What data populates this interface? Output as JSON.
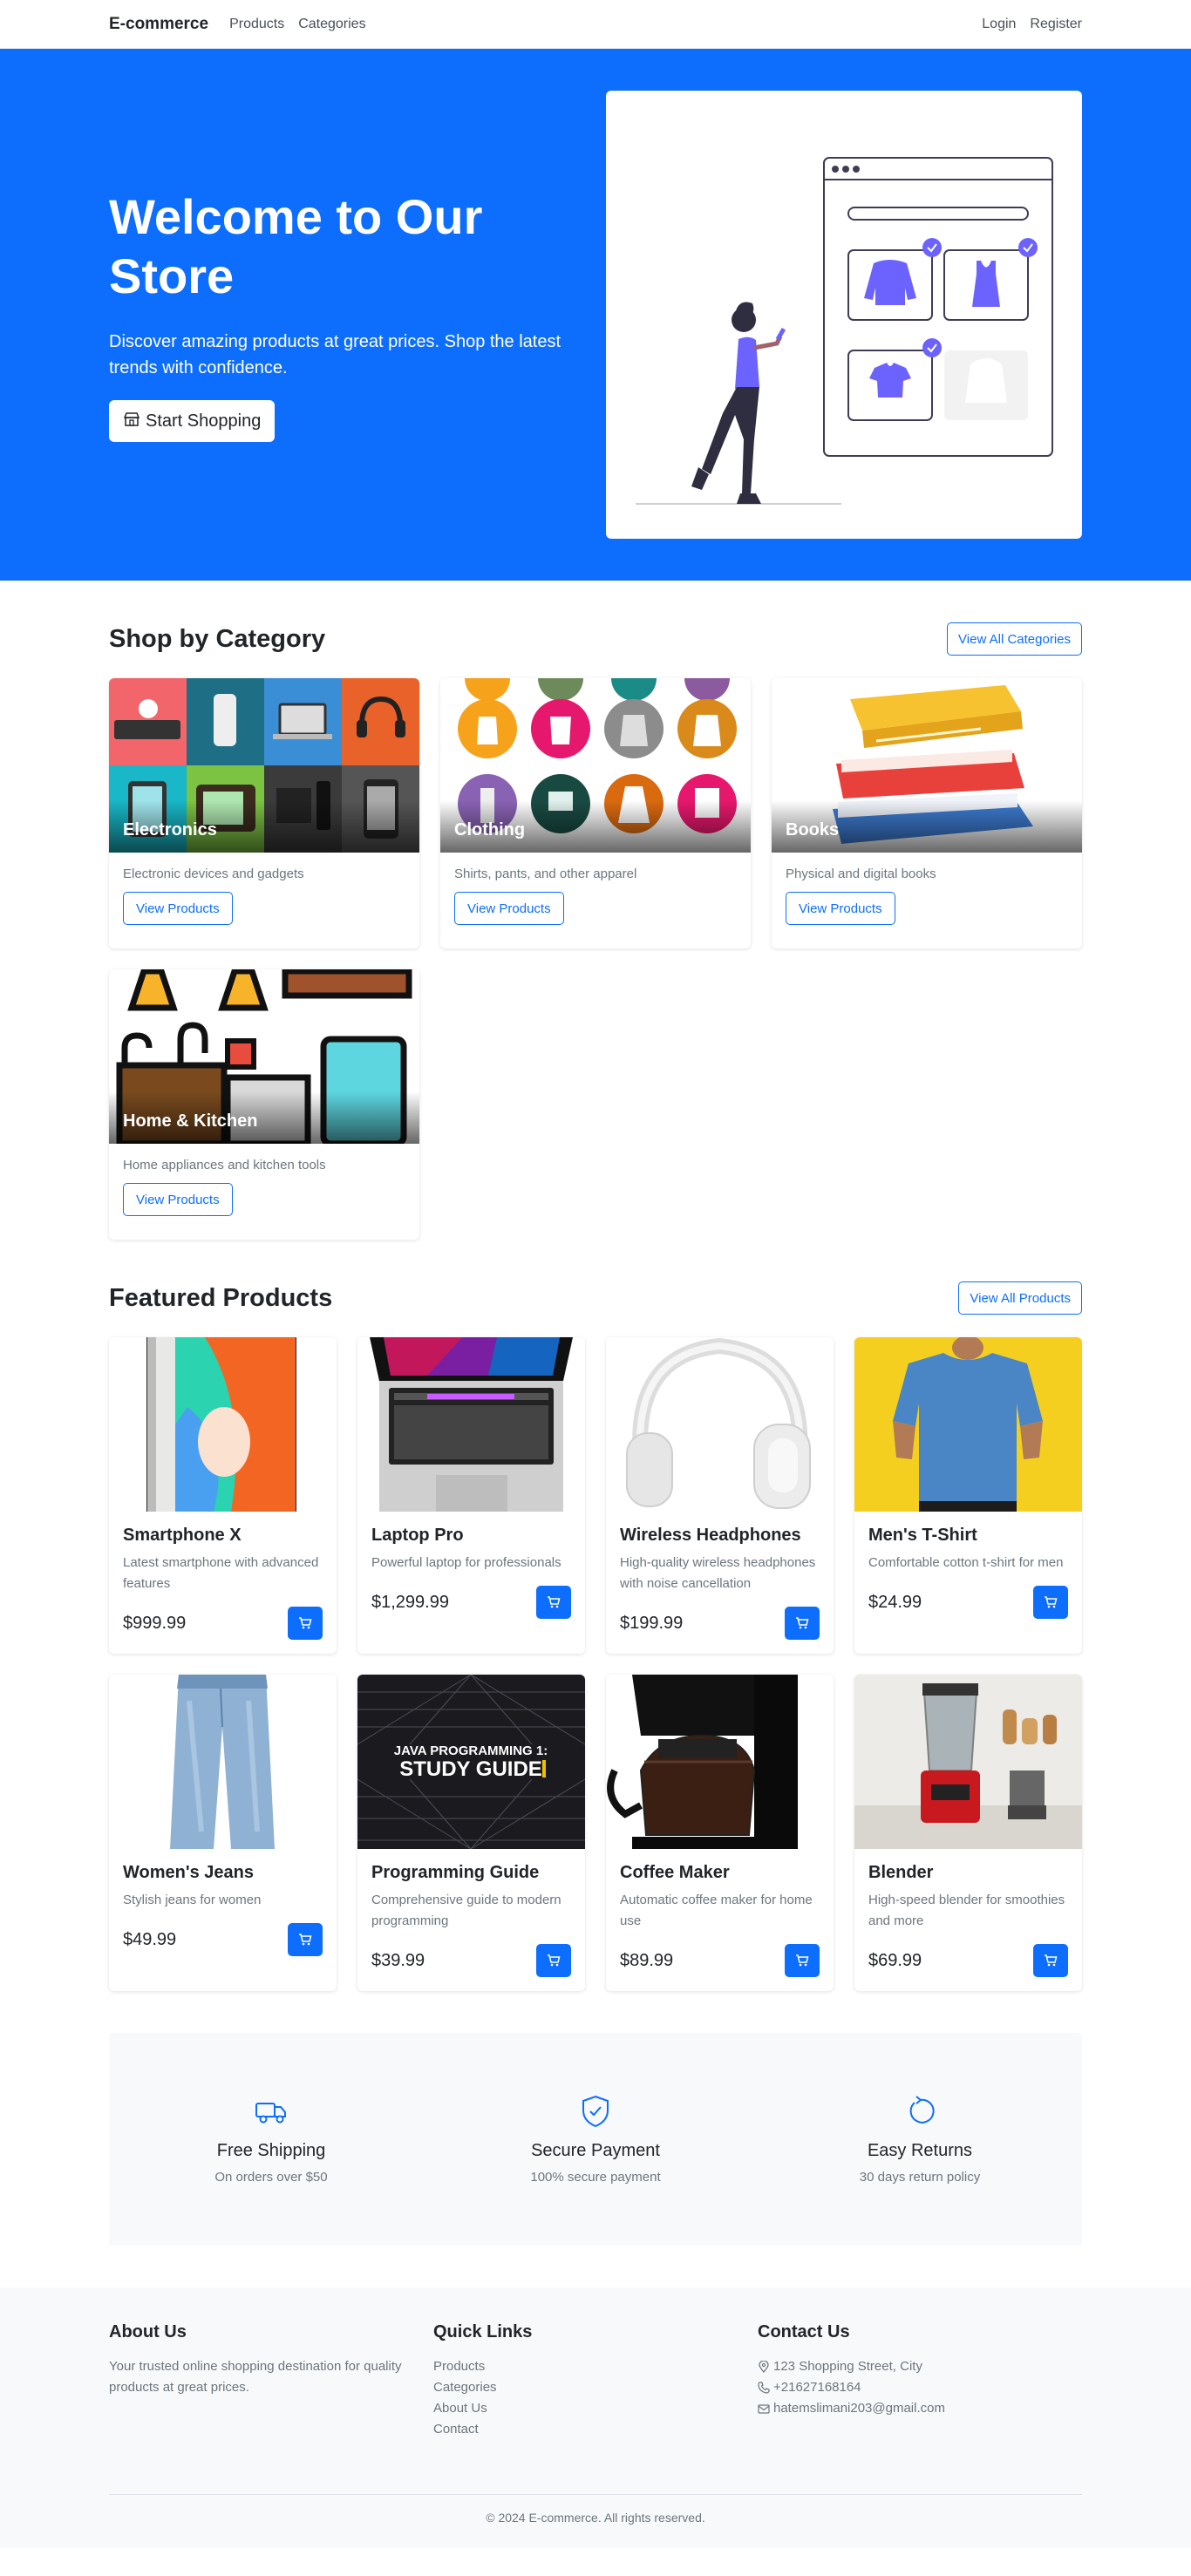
{
  "nav": {
    "brand": "E-commerce",
    "links": [
      "Products",
      "Categories"
    ],
    "login": "Login",
    "register": "Register"
  },
  "hero": {
    "title": "Welcome to Our Store",
    "subtitle": "Discover amazing products at great prices. Shop the latest trends with confidence.",
    "button_label": "Start Shopping",
    "button_icon": "shop-icon"
  },
  "categories": {
    "title": "Shop by Category",
    "view_all": "View All Categories",
    "items": [
      {
        "name": "Electronics",
        "description": "Electronic devices and gadgets",
        "button": "View Products"
      },
      {
        "name": "Clothing",
        "description": "Shirts, pants, and other apparel",
        "button": "View Products"
      },
      {
        "name": "Books",
        "description": "Physical and digital books",
        "button": "View Products"
      },
      {
        "name": "Home & Kitchen",
        "description": "Home appliances and kitchen tools",
        "button": "View Products"
      }
    ]
  },
  "featured": {
    "title": "Featured Products",
    "view_all": "View All Products",
    "products": [
      {
        "name": "Smartphone X",
        "description": "Latest smartphone with advanced features",
        "price": "$999.99"
      },
      {
        "name": "Laptop Pro",
        "description": "Powerful laptop for professionals",
        "price": "$1,299.99"
      },
      {
        "name": "Wireless Headphones",
        "description": "High-quality wireless headphones with noise cancellation",
        "price": "$199.99"
      },
      {
        "name": "Men's T-Shirt",
        "description": "Comfortable cotton t-shirt for men",
        "price": "$24.99"
      },
      {
        "name": "Women's Jeans",
        "description": "Stylish jeans for women",
        "price": "$49.99"
      },
      {
        "name": "Programming Guide",
        "description": "Comprehensive guide to modern programming",
        "price": "$39.99",
        "cover_line1": "JAVA PROGRAMMING 1:",
        "cover_line2": "STUDY GUIDE"
      },
      {
        "name": "Coffee Maker",
        "description": "Automatic coffee maker for home use",
        "price": "$89.99"
      },
      {
        "name": "Blender",
        "description": "High-speed blender for smoothies and more",
        "price": "$69.99"
      }
    ]
  },
  "features": [
    {
      "title": "Free Shipping",
      "subtitle": "On orders over $50",
      "icon": "truck-icon"
    },
    {
      "title": "Secure Payment",
      "subtitle": "100% secure payment",
      "icon": "shield-check-icon"
    },
    {
      "title": "Easy Returns",
      "subtitle": "30 days return policy",
      "icon": "return-arrow-icon"
    }
  ],
  "footer": {
    "about_title": "About Us",
    "about_text": "Your trusted online shopping destination for quality products at great prices.",
    "links_title": "Quick Links",
    "links": [
      "Products",
      "Categories",
      "About Us",
      "Contact"
    ],
    "contact_title": "Contact Us",
    "address": "123 Shopping Street, City",
    "phone": "+21627168164",
    "email": "hatemslimani203@gmail.com",
    "copyright": "© 2024 E-commerce. All rights reserved."
  },
  "colors": {
    "primary": "#0d6efd",
    "muted": "#6c757d",
    "light_bg": "#f8f9fa",
    "illustration_accent": "#6c63ff"
  }
}
